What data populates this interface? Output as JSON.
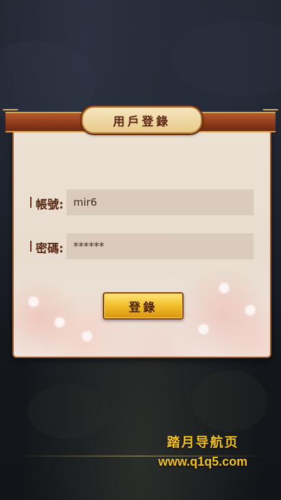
{
  "dialog": {
    "title": "用戶登錄"
  },
  "form": {
    "account_label": "帳號:",
    "account_value": "mir6",
    "password_label": "密碼:",
    "password_value": "******"
  },
  "buttons": {
    "login_label": "登錄"
  },
  "watermark": {
    "title": "踏月导航页",
    "url": "www.q1q5.com"
  },
  "colors": {
    "panel_bg": "#ece2d4",
    "header_bar": "#8c3a1a",
    "button_gold": "#f2bd2a",
    "watermark_gold": "#f2c21a"
  }
}
